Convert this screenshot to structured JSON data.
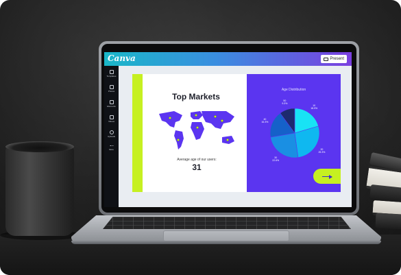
{
  "app": {
    "logo": "Canva",
    "present_label": "Present",
    "sidebar": [
      {
        "label": "Templates",
        "icon": "templates-icon"
      },
      {
        "label": "Photos",
        "icon": "photos-icon"
      },
      {
        "label": "Elements",
        "icon": "elements-icon"
      },
      {
        "label": "Videos",
        "icon": "videos-icon"
      },
      {
        "label": "Uploads",
        "icon": "uploads-icon"
      },
      {
        "label": "More",
        "icon": "more-icon"
      }
    ]
  },
  "slide": {
    "title": "Top Markets",
    "avg_label": "Average age of our users:",
    "avg_value": "31",
    "age_title": "Age Distribution"
  },
  "chart_data": {
    "type": "pie",
    "title": "Age Distribution",
    "slices": [
      {
        "label": "10",
        "value": 18.9,
        "display": "10\n18.9%"
      },
      {
        "label": "20",
        "value": 25.3,
        "display": "20\n25.3%"
      },
      {
        "label": "30",
        "value": 22.6,
        "display": "30\n22.6%"
      },
      {
        "label": "40",
        "value": 16.3,
        "display": "40\n16.3%"
      },
      {
        "label": "50",
        "value": 9.3,
        "display": "50\n9.3%"
      }
    ]
  },
  "colors": {
    "brand_gradient_start": "#1ab7c8",
    "brand_gradient_end": "#7b3fe0",
    "slide_purple": "#5b35f0",
    "accent_lime": "#c6f021"
  }
}
